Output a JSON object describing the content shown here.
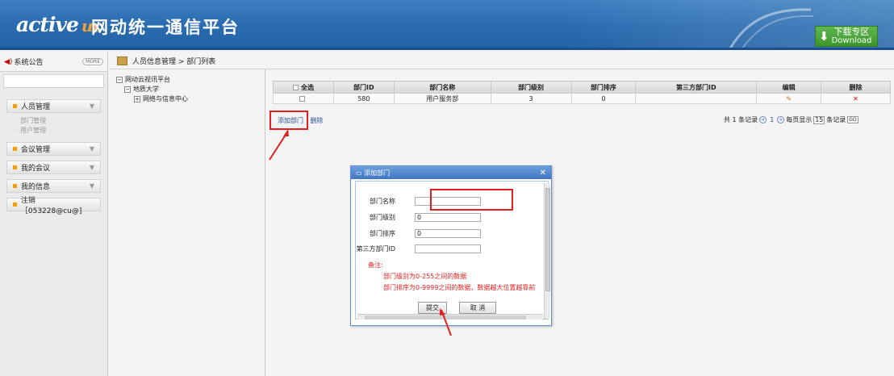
{
  "header": {
    "logo_text": "active",
    "logo_suffix": "uc",
    "title": "网动统一通信平台",
    "download_line1": "下载专区",
    "download_line2": "Download"
  },
  "sidebar": {
    "notice_label": "系统公告",
    "more_label": "MORE",
    "menu": [
      {
        "label": "人员管理",
        "subitems": [
          "部门管理",
          "用户管理"
        ]
      },
      {
        "label": "会议管理"
      },
      {
        "label": "我的会议"
      },
      {
        "label": "我的信息"
      },
      {
        "label": "注销［053228@cu@]"
      }
    ]
  },
  "breadcrumb": {
    "text": "人员信息管理 > 部门列表"
  },
  "tree": {
    "root": "网动云视讯平台",
    "child": "地质大学",
    "leaf": "网络与信息中心"
  },
  "table": {
    "headers": [
      "全选",
      "部门ID",
      "部门名称",
      "部门级别",
      "部门排序",
      "第三方部门ID",
      "编辑",
      "删除"
    ],
    "rows": [
      {
        "id": "580",
        "name": "用户服务部",
        "level": "3",
        "order": "0",
        "third": ""
      }
    ]
  },
  "actions": {
    "add": "添加部门",
    "delete": "删除"
  },
  "pager": {
    "total": "共 1 条记录",
    "current_page": "1",
    "per_page_prefix": "每页显示",
    "per_page": "15",
    "per_page_suffix": "条记录",
    "go": "GO"
  },
  "dialog": {
    "title": "添加部门",
    "fields": [
      {
        "label": "部门名称",
        "value": ""
      },
      {
        "label": "部门级别",
        "value": "0"
      },
      {
        "label": "部门排序",
        "value": "0"
      },
      {
        "label": "第三方部门ID",
        "value": ""
      }
    ],
    "note_title": "备注:",
    "notes": [
      "部门级别为0-255之间的数据",
      "部门排序为0-9999之间的数据，数据越大位置越靠前"
    ],
    "submit": "提交",
    "cancel": "取 消"
  },
  "colors": {
    "header_blue": "#2a6bb0",
    "annotation_red": "#e02020",
    "download_green": "#4aa63b"
  }
}
